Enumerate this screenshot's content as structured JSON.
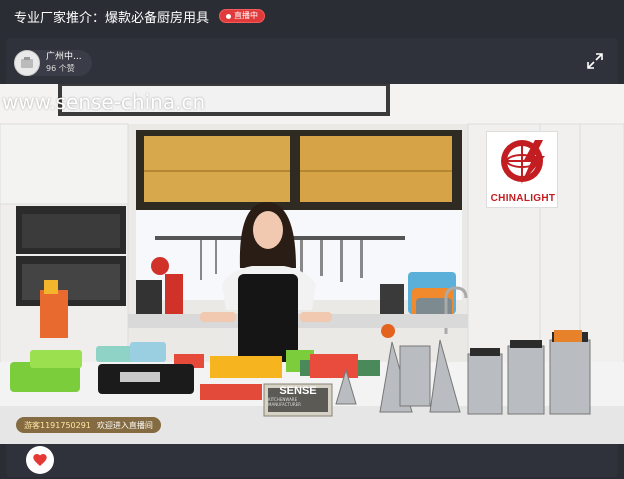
{
  "header": {
    "title": "专业厂家推介：爆款必备厨房用具",
    "live_label": "直播中"
  },
  "host": {
    "name": "广州中...",
    "likes": "96 个赞"
  },
  "video": {
    "watermark": "www.sense-china.cn",
    "logo_text": "CHINALIGHT",
    "sign_text": "SENSE",
    "sign_subtext": "KITCHENWARE MANUFACTURER"
  },
  "chat": {
    "user": "游客1191750291",
    "message": "欢迎进入直播间"
  },
  "colors": {
    "background": "#2b2d35",
    "live_badge": "#e03a3a",
    "logo_red": "#c21d21",
    "like_heart": "#e53935"
  },
  "icons": {
    "expand": "expand-icon",
    "like": "heart-icon",
    "logo": "globe-lightning-icon"
  }
}
